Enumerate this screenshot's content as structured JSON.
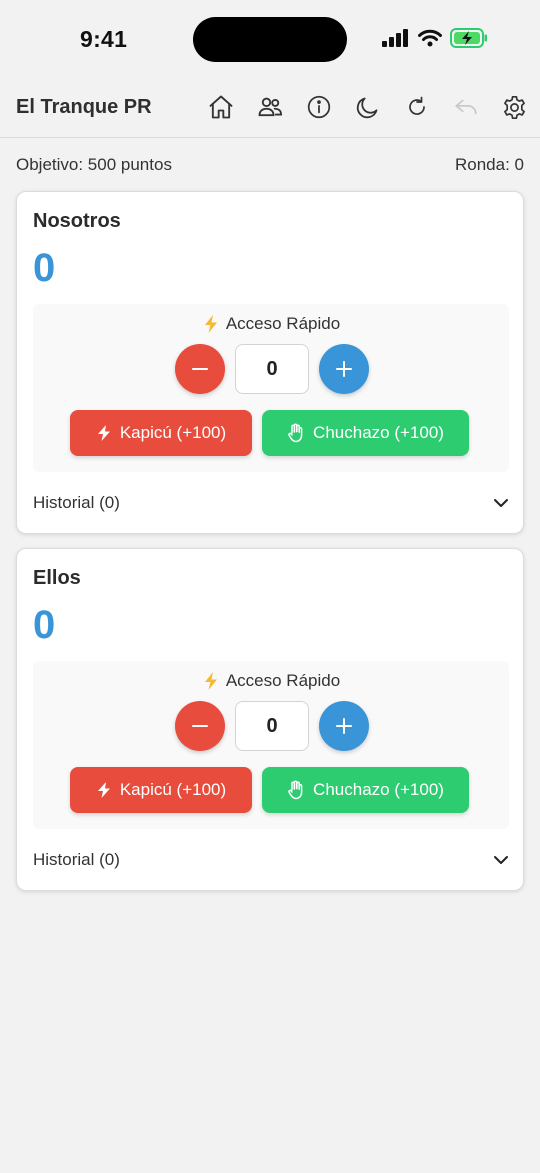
{
  "status_bar": {
    "time": "9:41"
  },
  "header": {
    "title": "El Tranque PR",
    "icons": [
      "home-icon",
      "users-icon",
      "info-icon",
      "moon-icon",
      "refresh-icon",
      "undo-icon",
      "settings-icon"
    ]
  },
  "game": {
    "target_label": "Objetivo: 500 puntos",
    "round_label": "Ronda: 0"
  },
  "teams": [
    {
      "name": "Nosotros",
      "score": "0",
      "quick_access_label": "Acceso Rápido",
      "stepper_value": "0",
      "kapicu_label": "Kapicú (+100)",
      "chuchazo_label": "Chuchazo (+100)",
      "history_label": "Historial (0)"
    },
    {
      "name": "Ellos",
      "score": "0",
      "quick_access_label": "Acceso Rápido",
      "stepper_value": "0",
      "kapicu_label": "Kapicú (+100)",
      "chuchazo_label": "Chuchazo (+100)",
      "history_label": "Historial (0)"
    }
  ],
  "colors": {
    "accent_blue": "#3a95d8",
    "danger_red": "#e74c3c",
    "success_green": "#2ecc71",
    "background": "#f2f2f2"
  }
}
